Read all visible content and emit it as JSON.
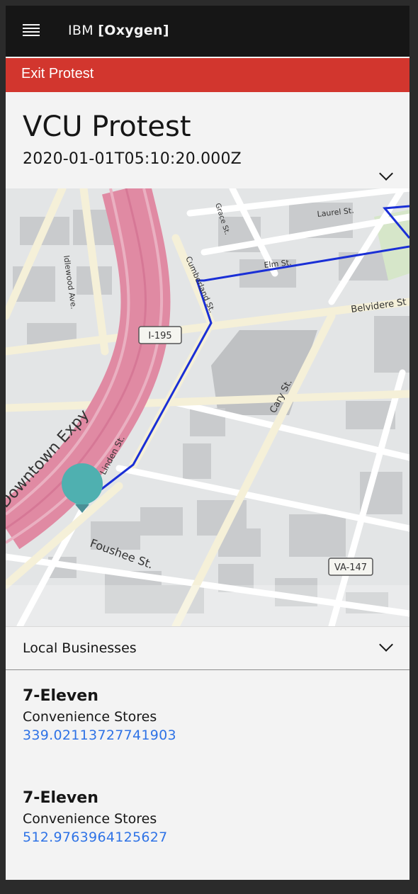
{
  "topbar": {
    "brand_prefix": "IBM",
    "brand_name": "[Oxygen]"
  },
  "exit_bar": {
    "label": "Exit Protest"
  },
  "event": {
    "title": "VCU Protest",
    "timestamp": "2020-01-01T05:10:20.000Z"
  },
  "map": {
    "labels": {
      "laurel": "Laurel St.",
      "grace": "Grace St.",
      "idlewood": "Idlewood Ave.",
      "cumberland": "Cumberland St.",
      "elm": "Elm St.",
      "belvidere": "Belvidere St",
      "shield_i195": "I-195",
      "cary": "Cary St.",
      "downtown": "Downtown Expy",
      "foushee": "Foushee St.",
      "shield_va147": "VA-147",
      "linden": "Linden St."
    },
    "pin_color": "#4fb0b0",
    "route_color": "#1a2fd6"
  },
  "businesses_section": {
    "label": "Local Businesses"
  },
  "businesses": [
    {
      "name": "7-Eleven",
      "category": "Convenience Stores",
      "distance": "339.02113727741903"
    },
    {
      "name": "7-Eleven",
      "category": "Convenience Stores",
      "distance": "512.9763964125627"
    }
  ]
}
